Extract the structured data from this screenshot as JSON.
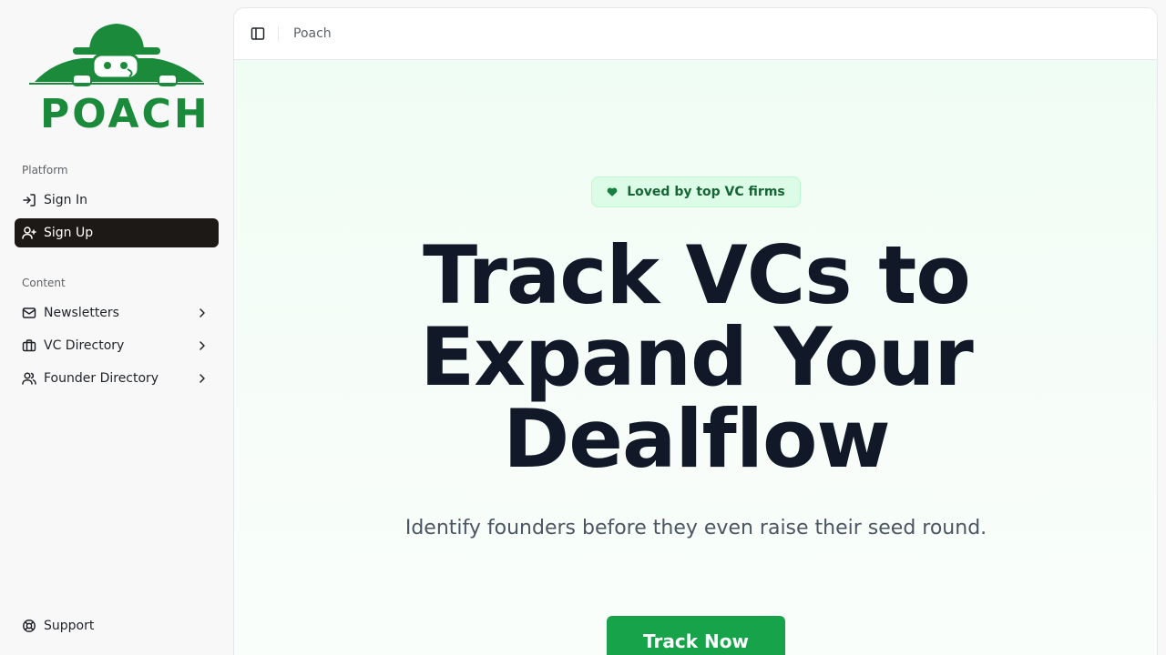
{
  "brand": {
    "logo_text": "POACH",
    "color": "#1b8a3a"
  },
  "sidebar": {
    "sections": [
      {
        "label": "Platform"
      },
      {
        "label": "Content"
      }
    ],
    "platform_items": [
      {
        "label": "Sign In",
        "icon": "sign-in-icon"
      },
      {
        "label": "Sign Up",
        "icon": "user-plus-icon",
        "active": true
      }
    ],
    "content_items": [
      {
        "label": "Newsletters",
        "icon": "mail-icon"
      },
      {
        "label": "VC Directory",
        "icon": "briefcase-icon"
      },
      {
        "label": "Founder Directory",
        "icon": "users-icon"
      }
    ],
    "footer_item": {
      "label": "Support",
      "icon": "lifebuoy-icon"
    }
  },
  "topbar": {
    "breadcrumb": "Poach"
  },
  "hero": {
    "badge": "Loved by top VC firms",
    "headline_lines": [
      "Track VCs to",
      "Expand Your",
      "Dealflow"
    ],
    "subtitle": "Identify founders before they even raise their seed round.",
    "cta": "Track Now"
  },
  "colors": {
    "accent": "#16a34a",
    "active_nav": "#1c1917",
    "badge_bg": "#dcfce7"
  }
}
